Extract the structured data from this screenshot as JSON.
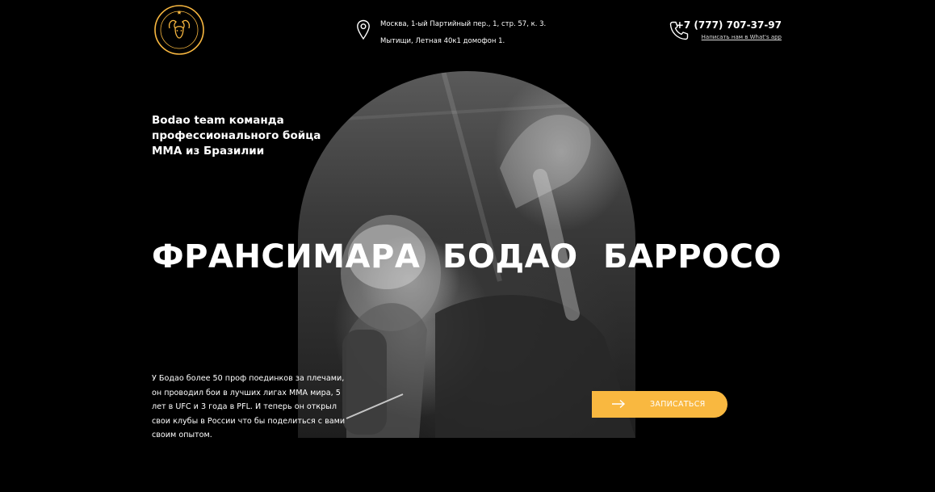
{
  "brand": {
    "logo_top_text": "BODAO",
    "logo_bottom_text": "FIGHT TEAM",
    "accent": "#f9b840"
  },
  "header": {
    "location_icon": "map-pin-icon",
    "address_line1": "Москва, 1-ый Партийный пер., 1, стр. 57, к. 3.",
    "address_line2": "Мытищи, Летная 40к1 домофон 1.",
    "phone_icon": "phone-icon",
    "phone": "+7 (777) 707-37-97",
    "whatsapp_link": "Написать нам в What's app"
  },
  "hero": {
    "tagline": "Bodao team команда профессионального бойца MMA из Бразилии",
    "name_first": "ФРАНСИМАРА",
    "name_middle": "БОДАО",
    "name_last": "БАРРОСО",
    "description": "У Бодао более 50 проф поединков за плечами, он проводил бои в лучших лигах MMA мира, 5 лет в UFC и 3 года в PFL. И теперь он открыл свои клубы в России что бы поделиться с вами своим опытом.",
    "cta_label": "ЗАПИСАТЬСЯ",
    "cta_icon": "arrow-right-icon"
  }
}
